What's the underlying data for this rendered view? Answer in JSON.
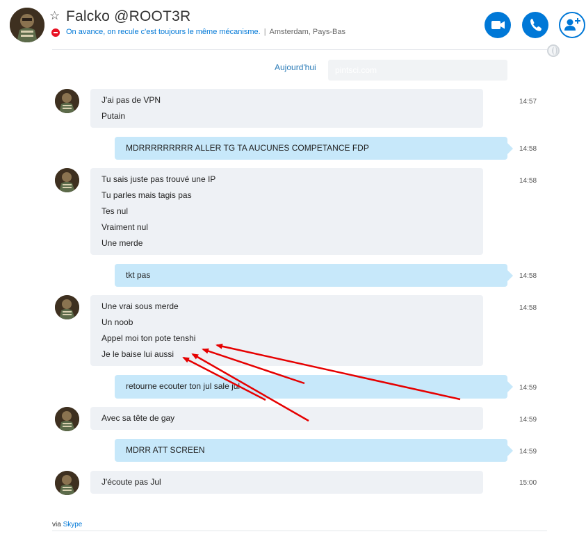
{
  "header": {
    "contact_name": "Falcko @ROOT3R",
    "status_message": "On avance, on recule c'est toujours le même mécanisme.",
    "separator": "|",
    "location": "Amsterdam, Pays-Bas",
    "status": "do-not-disturb",
    "icons": {
      "favorite": "star-outline-icon",
      "video": "video-call-icon",
      "call": "phone-call-icon",
      "add": "add-contact-icon",
      "globe": "globe-icon"
    }
  },
  "conversation": {
    "day_label": "Aujourd'hui",
    "watermark": "pintsci.com",
    "messages": [
      {
        "dir": "in",
        "lines": [
          "J'ai pas de VPN",
          "Putain"
        ],
        "time": "14:57"
      },
      {
        "dir": "out",
        "lines": [
          "MDRRRRRRRRR ALLER TG TA AUCUNES COMPETANCE FDP"
        ],
        "time": "14:58"
      },
      {
        "dir": "in",
        "lines": [
          "Tu sais juste pas trouvé une IP",
          "Tu parles mais tagis pas",
          "Tes nul",
          "Vraiment nul",
          "Une merde"
        ],
        "time": "14:58"
      },
      {
        "dir": "out",
        "lines": [
          "tkt pas"
        ],
        "time": "14:58"
      },
      {
        "dir": "in",
        "lines": [
          "Une vrai sous merde",
          "Un noob",
          "Appel moi ton pote tenshi",
          "Je le baise lui aussi"
        ],
        "time": "14:58"
      },
      {
        "dir": "out",
        "lines": [
          "retourne ecouter ton jul sale jul"
        ],
        "time": "14:59"
      },
      {
        "dir": "in",
        "lines": [
          "Avec sa tête de gay"
        ],
        "time": "14:59"
      },
      {
        "dir": "out",
        "lines": [
          "MDRR ATT SCREEN"
        ],
        "time": "14:59"
      },
      {
        "dir": "in",
        "lines": [
          "J'écoute pas Jul"
        ],
        "time": "15:00"
      }
    ]
  },
  "footer": {
    "via": "via",
    "link": "Skype"
  },
  "colors": {
    "accent": "#0078d7",
    "incoming_bubble": "#eef1f5",
    "outgoing_bubble": "#c7e8fa",
    "annotation_arrows": "#e60000",
    "dnd": "#e81123"
  }
}
